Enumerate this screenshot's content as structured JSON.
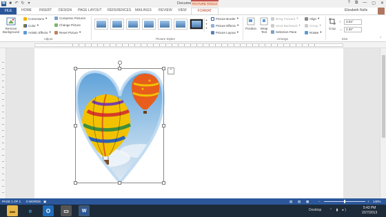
{
  "window": {
    "title": "Document1 - Word",
    "app_icon": "W",
    "qat_icons": [
      "save-icon",
      "undo-icon",
      "redo-icon",
      "customize-icon"
    ],
    "contextual_tab_group": "PICTURE TOOLS",
    "controls": [
      "?",
      "⧉",
      "—",
      "▢",
      "✕"
    ]
  },
  "tabs": {
    "file": "FILE",
    "items": [
      "HOME",
      "INSERT",
      "DESIGN",
      "PAGE LAYOUT",
      "REFERENCES",
      "MAILINGS",
      "REVIEW",
      "VIEW"
    ],
    "active": "FORMAT",
    "user": "Elizabeth Nolls"
  },
  "ribbon": {
    "adjust": {
      "label": "Adjust",
      "remove_background": [
        "Remove",
        "Background"
      ],
      "items": [
        "Corrections",
        "Color",
        "Artistic Effects"
      ],
      "items2": [
        "Compress Pictures",
        "Change Picture",
        "Reset Picture"
      ]
    },
    "picture_styles": {
      "label": "Picture Styles",
      "items": [
        "Picture Border",
        "Picture Effects",
        "Picture Layout"
      ]
    },
    "arrange": {
      "label": "Arrange",
      "position": "Position",
      "wrap_text": [
        "Wrap",
        "Text"
      ],
      "items": [
        "Bring Forward",
        "Send Backward",
        "Selection Pane"
      ],
      "items2": [
        "Align",
        "Group",
        "Rotate"
      ]
    },
    "size": {
      "label": "Size",
      "crop": "Crop",
      "height": "3.04\"",
      "width": "2.32\""
    }
  },
  "statusbar": {
    "page": "PAGE 1 OF 1",
    "words": "0 WORDS",
    "zoom": "140%"
  },
  "taskbar": {
    "desktop": "Desktop",
    "time": "5:43 PM",
    "date": "2/27/2013",
    "app_icons": [
      "folder-icon",
      "internet-explorer-icon",
      "outlook-icon",
      "windows-explorer-icon",
      "word-icon"
    ]
  },
  "colors": {
    "word_blue": "#2b579a",
    "picture_tools": "#b84a2e"
  }
}
